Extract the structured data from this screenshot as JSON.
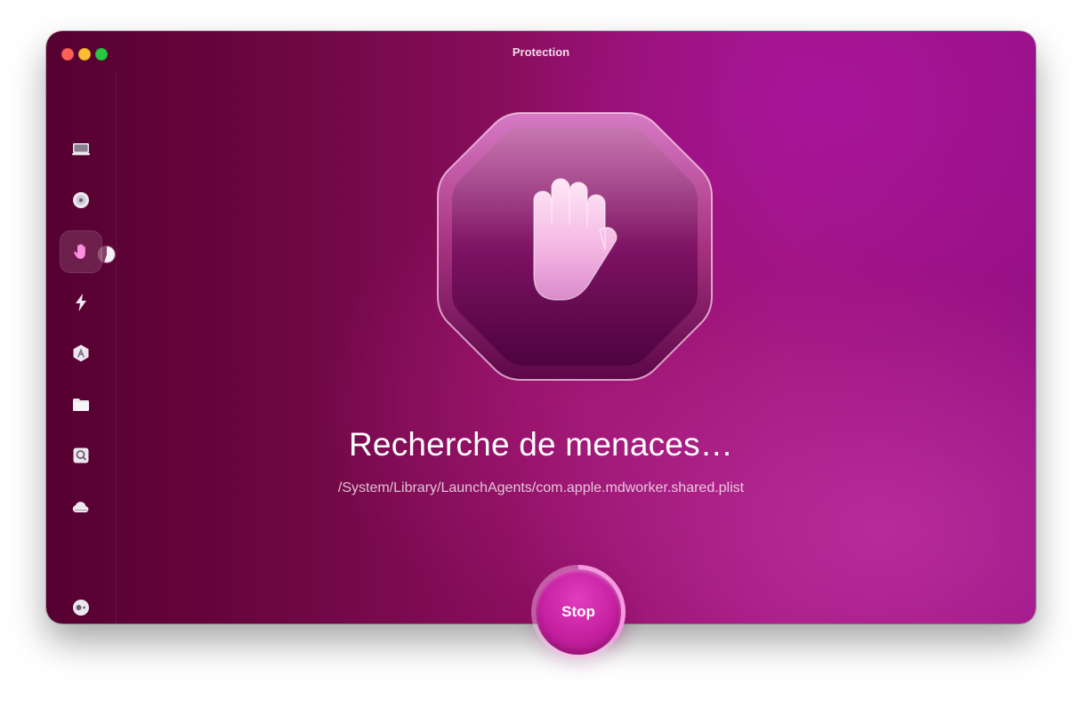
{
  "window": {
    "title": "Protection"
  },
  "sidebar": {
    "items": [
      {
        "id": "cleanup",
        "icon": "monitor-icon",
        "active": false
      },
      {
        "id": "smart-care",
        "icon": "disc-icon",
        "active": false
      },
      {
        "id": "protection",
        "icon": "hand-icon",
        "active": true
      },
      {
        "id": "performance",
        "icon": "lightning-icon",
        "active": false
      },
      {
        "id": "applications",
        "icon": "app-store-icon",
        "active": false
      },
      {
        "id": "my-clutter",
        "icon": "folder-icon",
        "active": false
      },
      {
        "id": "space-lens",
        "icon": "lens-icon",
        "active": false
      },
      {
        "id": "cloud-cleanup",
        "icon": "cloud-icon",
        "active": false
      }
    ],
    "bottom_icon": "assistant-icon",
    "scan_progress": 0.55
  },
  "main": {
    "hero_icon": "stop-hand-icon",
    "heading": "Recherche de menaces…",
    "current_path": "/System/Library/LaunchAgents/com.apple.mdworker.shared.plist",
    "stop_label": "Stop",
    "stop_progress": 0.36
  },
  "colors": {
    "accent": "#c5209f",
    "background_dark": "#560031",
    "background_light": "#a0147c"
  }
}
